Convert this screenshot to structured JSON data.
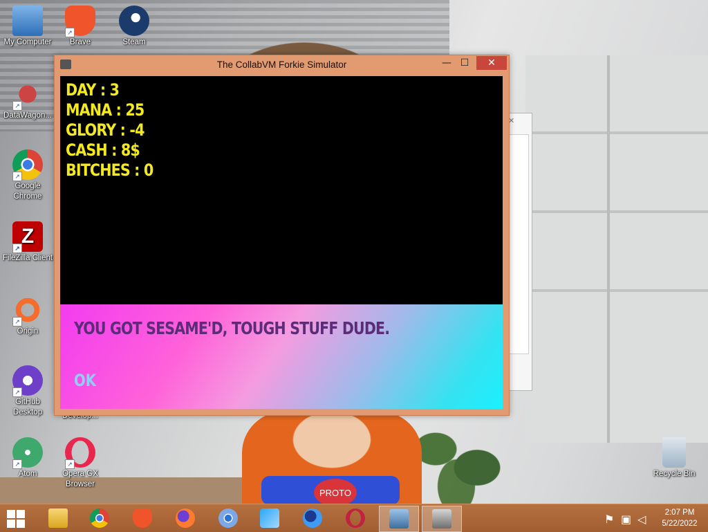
{
  "desktop": {
    "icons": [
      {
        "label": "My Computer",
        "icon": "computer-icon"
      },
      {
        "label": "Brave",
        "icon": "brave-icon"
      },
      {
        "label": "Steam",
        "icon": "steam-icon"
      },
      {
        "label": "DataWagon...",
        "icon": "datawagon-icon"
      },
      {
        "label": "Google Chrome",
        "icon": "chrome-icon"
      },
      {
        "label": "FileZilla Client",
        "icon": "filezilla-icon"
      },
      {
        "label": "Origin",
        "icon": "origin-icon"
      },
      {
        "label": "GitHub Desktop",
        "icon": "github-icon"
      },
      {
        "label": "Develop...",
        "icon": "develop-icon"
      },
      {
        "label": "Atom",
        "icon": "atom-icon"
      },
      {
        "label": "Opera GX Browser",
        "icon": "opera-gx-icon"
      },
      {
        "label": "Recycle Bin",
        "icon": "recycle-bin-icon"
      }
    ],
    "wallpaper_badge": "PROTO"
  },
  "window": {
    "title": "The CollabVM Forkie Simulator",
    "controls": {
      "minimize": "—",
      "maximize": "☐",
      "close": "✕"
    },
    "stats": [
      "DAY : 3",
      "MANA : 25",
      "GLORY : -4",
      "CASH : 8$",
      "BITCHES : 0"
    ],
    "dialog": {
      "message": "YOU GOT SESAME'D, TOUGH STUFF DUDE.",
      "ok_label": "OK"
    }
  },
  "taskbar": {
    "apps": [
      {
        "icon": "file-explorer-icon"
      },
      {
        "icon": "chrome-icon"
      },
      {
        "icon": "brave-icon"
      },
      {
        "icon": "firefox-icon"
      },
      {
        "icon": "chromium-icon"
      },
      {
        "icon": "xcode-like-icon"
      },
      {
        "icon": "firefox-dev-icon"
      },
      {
        "icon": "opera-icon"
      },
      {
        "icon": "network-setup-icon"
      },
      {
        "icon": "forkie-simulator-icon"
      }
    ],
    "tray": {
      "flag": "action-center-icon",
      "network": "network-icon",
      "volume": "volume-muted-icon"
    },
    "clock": {
      "time": "2:07 PM",
      "date": "5/22/2022"
    }
  }
}
